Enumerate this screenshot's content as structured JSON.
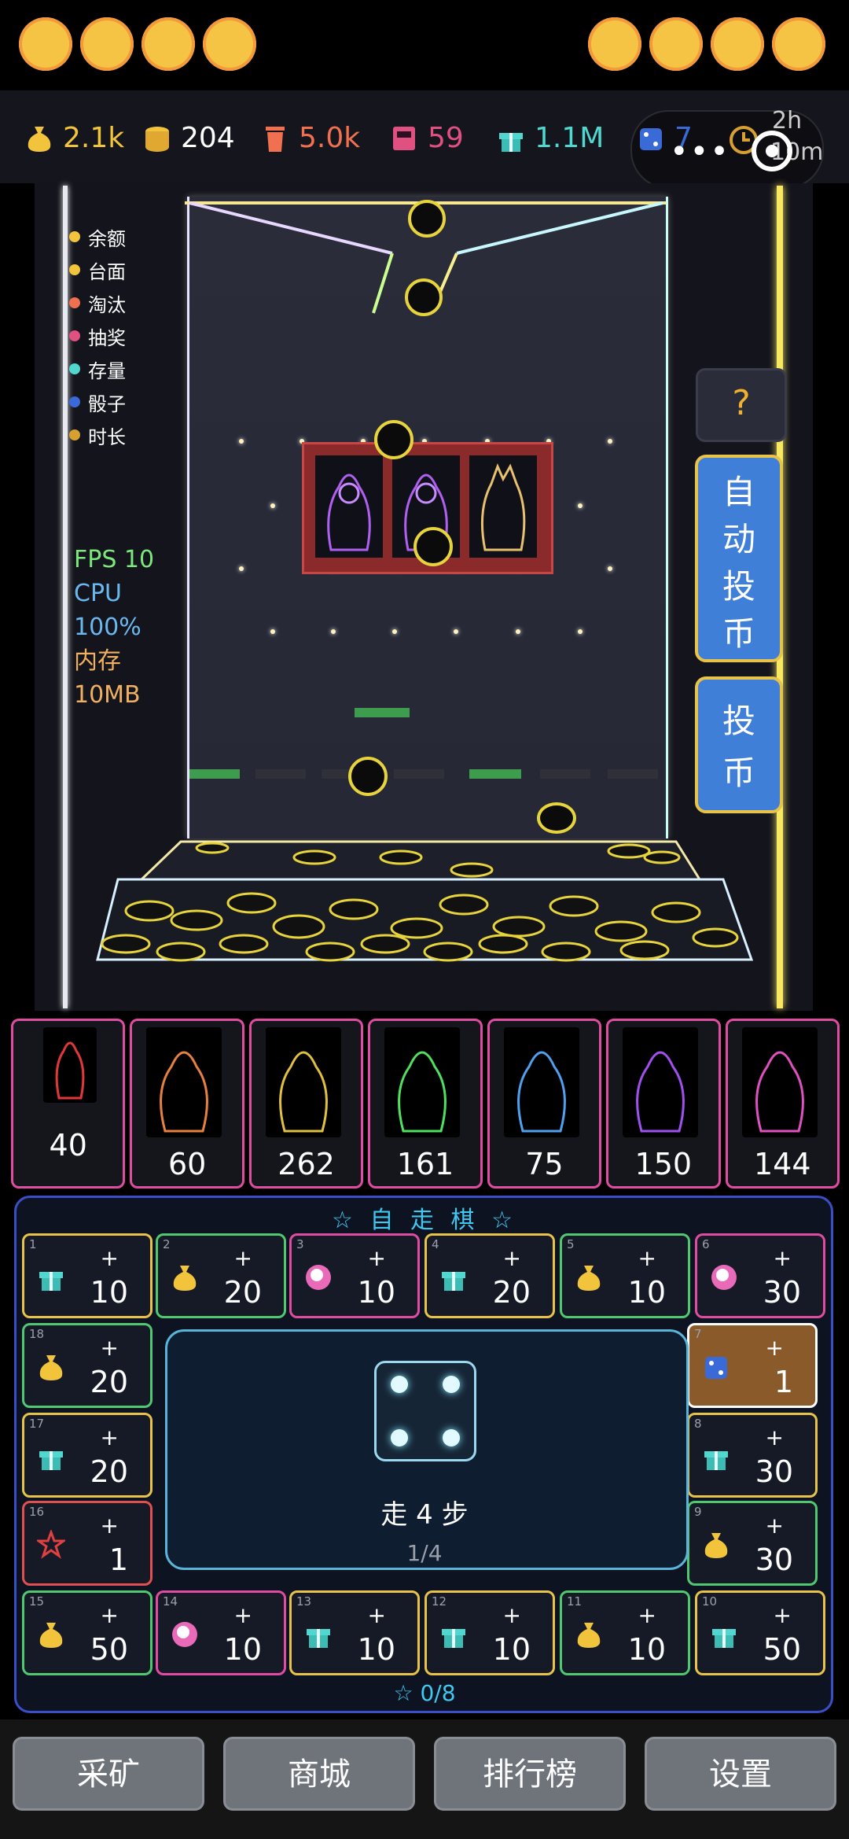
{
  "hud": {
    "stats": [
      {
        "icon": "money-bag-icon",
        "value": "2.1k",
        "color": "#f2c43c"
      },
      {
        "icon": "coin-stack-icon",
        "value": "204",
        "color": "#ffffff"
      },
      {
        "icon": "trash-icon",
        "value": "5.0k",
        "color": "#f07050"
      },
      {
        "icon": "lottery-machine-icon",
        "value": "59",
        "color": "#e05080"
      },
      {
        "icon": "gift-box-icon",
        "value": "1.1M",
        "color": "#50d8d0"
      },
      {
        "icon": "dice-icon",
        "value": "7",
        "color": "#3a6ad8"
      },
      {
        "icon": "clock-icon",
        "value": "2h",
        "color": "#d8a030"
      }
    ],
    "time_minutes": "10m"
  },
  "legend": [
    {
      "label": "余额",
      "color": "#f2c43c"
    },
    {
      "label": "台面",
      "color": "#f2c43c"
    },
    {
      "label": "淘汰",
      "color": "#f07050"
    },
    {
      "label": "抽奖",
      "color": "#e05080"
    },
    {
      "label": "存量",
      "color": "#50d8d0"
    },
    {
      "label": "骰子",
      "color": "#3a6ad8"
    },
    {
      "label": "时长",
      "color": "#d8a030"
    }
  ],
  "perf": {
    "fps": "FPS 10",
    "cpu_label": "CPU",
    "cpu_value": "100%",
    "mem_label": "内存",
    "mem_value": "10MB"
  },
  "side_buttons": {
    "help": "?",
    "auto_coin": [
      "自",
      "动",
      "投",
      "币"
    ],
    "coin": [
      "投",
      "币"
    ]
  },
  "cards": [
    {
      "value": "40",
      "art": "red"
    },
    {
      "value": "60",
      "art": "orange"
    },
    {
      "value": "262",
      "art": "gold"
    },
    {
      "value": "161",
      "art": "green"
    },
    {
      "value": "75",
      "art": "blue"
    },
    {
      "value": "150",
      "art": "purple"
    },
    {
      "value": "144",
      "art": "pink"
    }
  ],
  "board": {
    "title": "☆ 自 走 棋 ☆",
    "tiles": [
      {
        "idx": "1",
        "icon": "gift-box-icon",
        "plus": "+",
        "value": "10",
        "border": "#e8c34a"
      },
      {
        "idx": "2",
        "icon": "money-bag-icon",
        "plus": "+",
        "value": "20",
        "border": "#4fc870"
      },
      {
        "idx": "3",
        "icon": "character-icon",
        "plus": "+",
        "value": "10",
        "border": "#e14ca3"
      },
      {
        "idx": "4",
        "icon": "gift-box-icon",
        "plus": "+",
        "value": "20",
        "border": "#e8c34a"
      },
      {
        "idx": "5",
        "icon": "money-bag-icon",
        "plus": "+",
        "value": "10",
        "border": "#4fc870"
      },
      {
        "idx": "6",
        "icon": "character-icon",
        "plus": "+",
        "value": "30",
        "border": "#e14ca3"
      },
      {
        "idx": "7",
        "icon": "dice-icon",
        "plus": "+",
        "value": "1",
        "border": "#ffffff"
      },
      {
        "idx": "8",
        "icon": "gift-box-icon",
        "plus": "+",
        "value": "30",
        "border": "#e8c34a"
      },
      {
        "idx": "9",
        "icon": "money-bag-icon",
        "plus": "+",
        "value": "30",
        "border": "#4fc870"
      },
      {
        "idx": "10",
        "icon": "gift-box-icon",
        "plus": "+",
        "value": "50",
        "border": "#e8c34a"
      },
      {
        "idx": "11",
        "icon": "money-bag-icon",
        "plus": "+",
        "value": "10",
        "border": "#4fc870"
      },
      {
        "idx": "12",
        "icon": "gift-box-icon",
        "plus": "+",
        "value": "10",
        "border": "#e8c34a"
      },
      {
        "idx": "13",
        "icon": "gift-box-icon",
        "plus": "+",
        "value": "10",
        "border": "#e8c34a"
      },
      {
        "idx": "14",
        "icon": "character-icon",
        "plus": "+",
        "value": "10",
        "border": "#e14ca3"
      },
      {
        "idx": "15",
        "icon": "money-bag-icon",
        "plus": "+",
        "value": "50",
        "border": "#4fc870"
      },
      {
        "idx": "16",
        "icon": "star-icon",
        "plus": "+",
        "value": "1",
        "border": "#e05050"
      },
      {
        "idx": "17",
        "icon": "gift-box-icon",
        "plus": "+",
        "value": "20",
        "border": "#e8c34a"
      },
      {
        "idx": "18",
        "icon": "money-bag-icon",
        "plus": "+",
        "value": "20",
        "border": "#4fc870"
      }
    ],
    "steps_text": "走 4 步",
    "steps_count": "1/4",
    "progress": "☆ 0/8"
  },
  "bottom_nav": [
    "采矿",
    "商城",
    "排行榜",
    "设置"
  ]
}
